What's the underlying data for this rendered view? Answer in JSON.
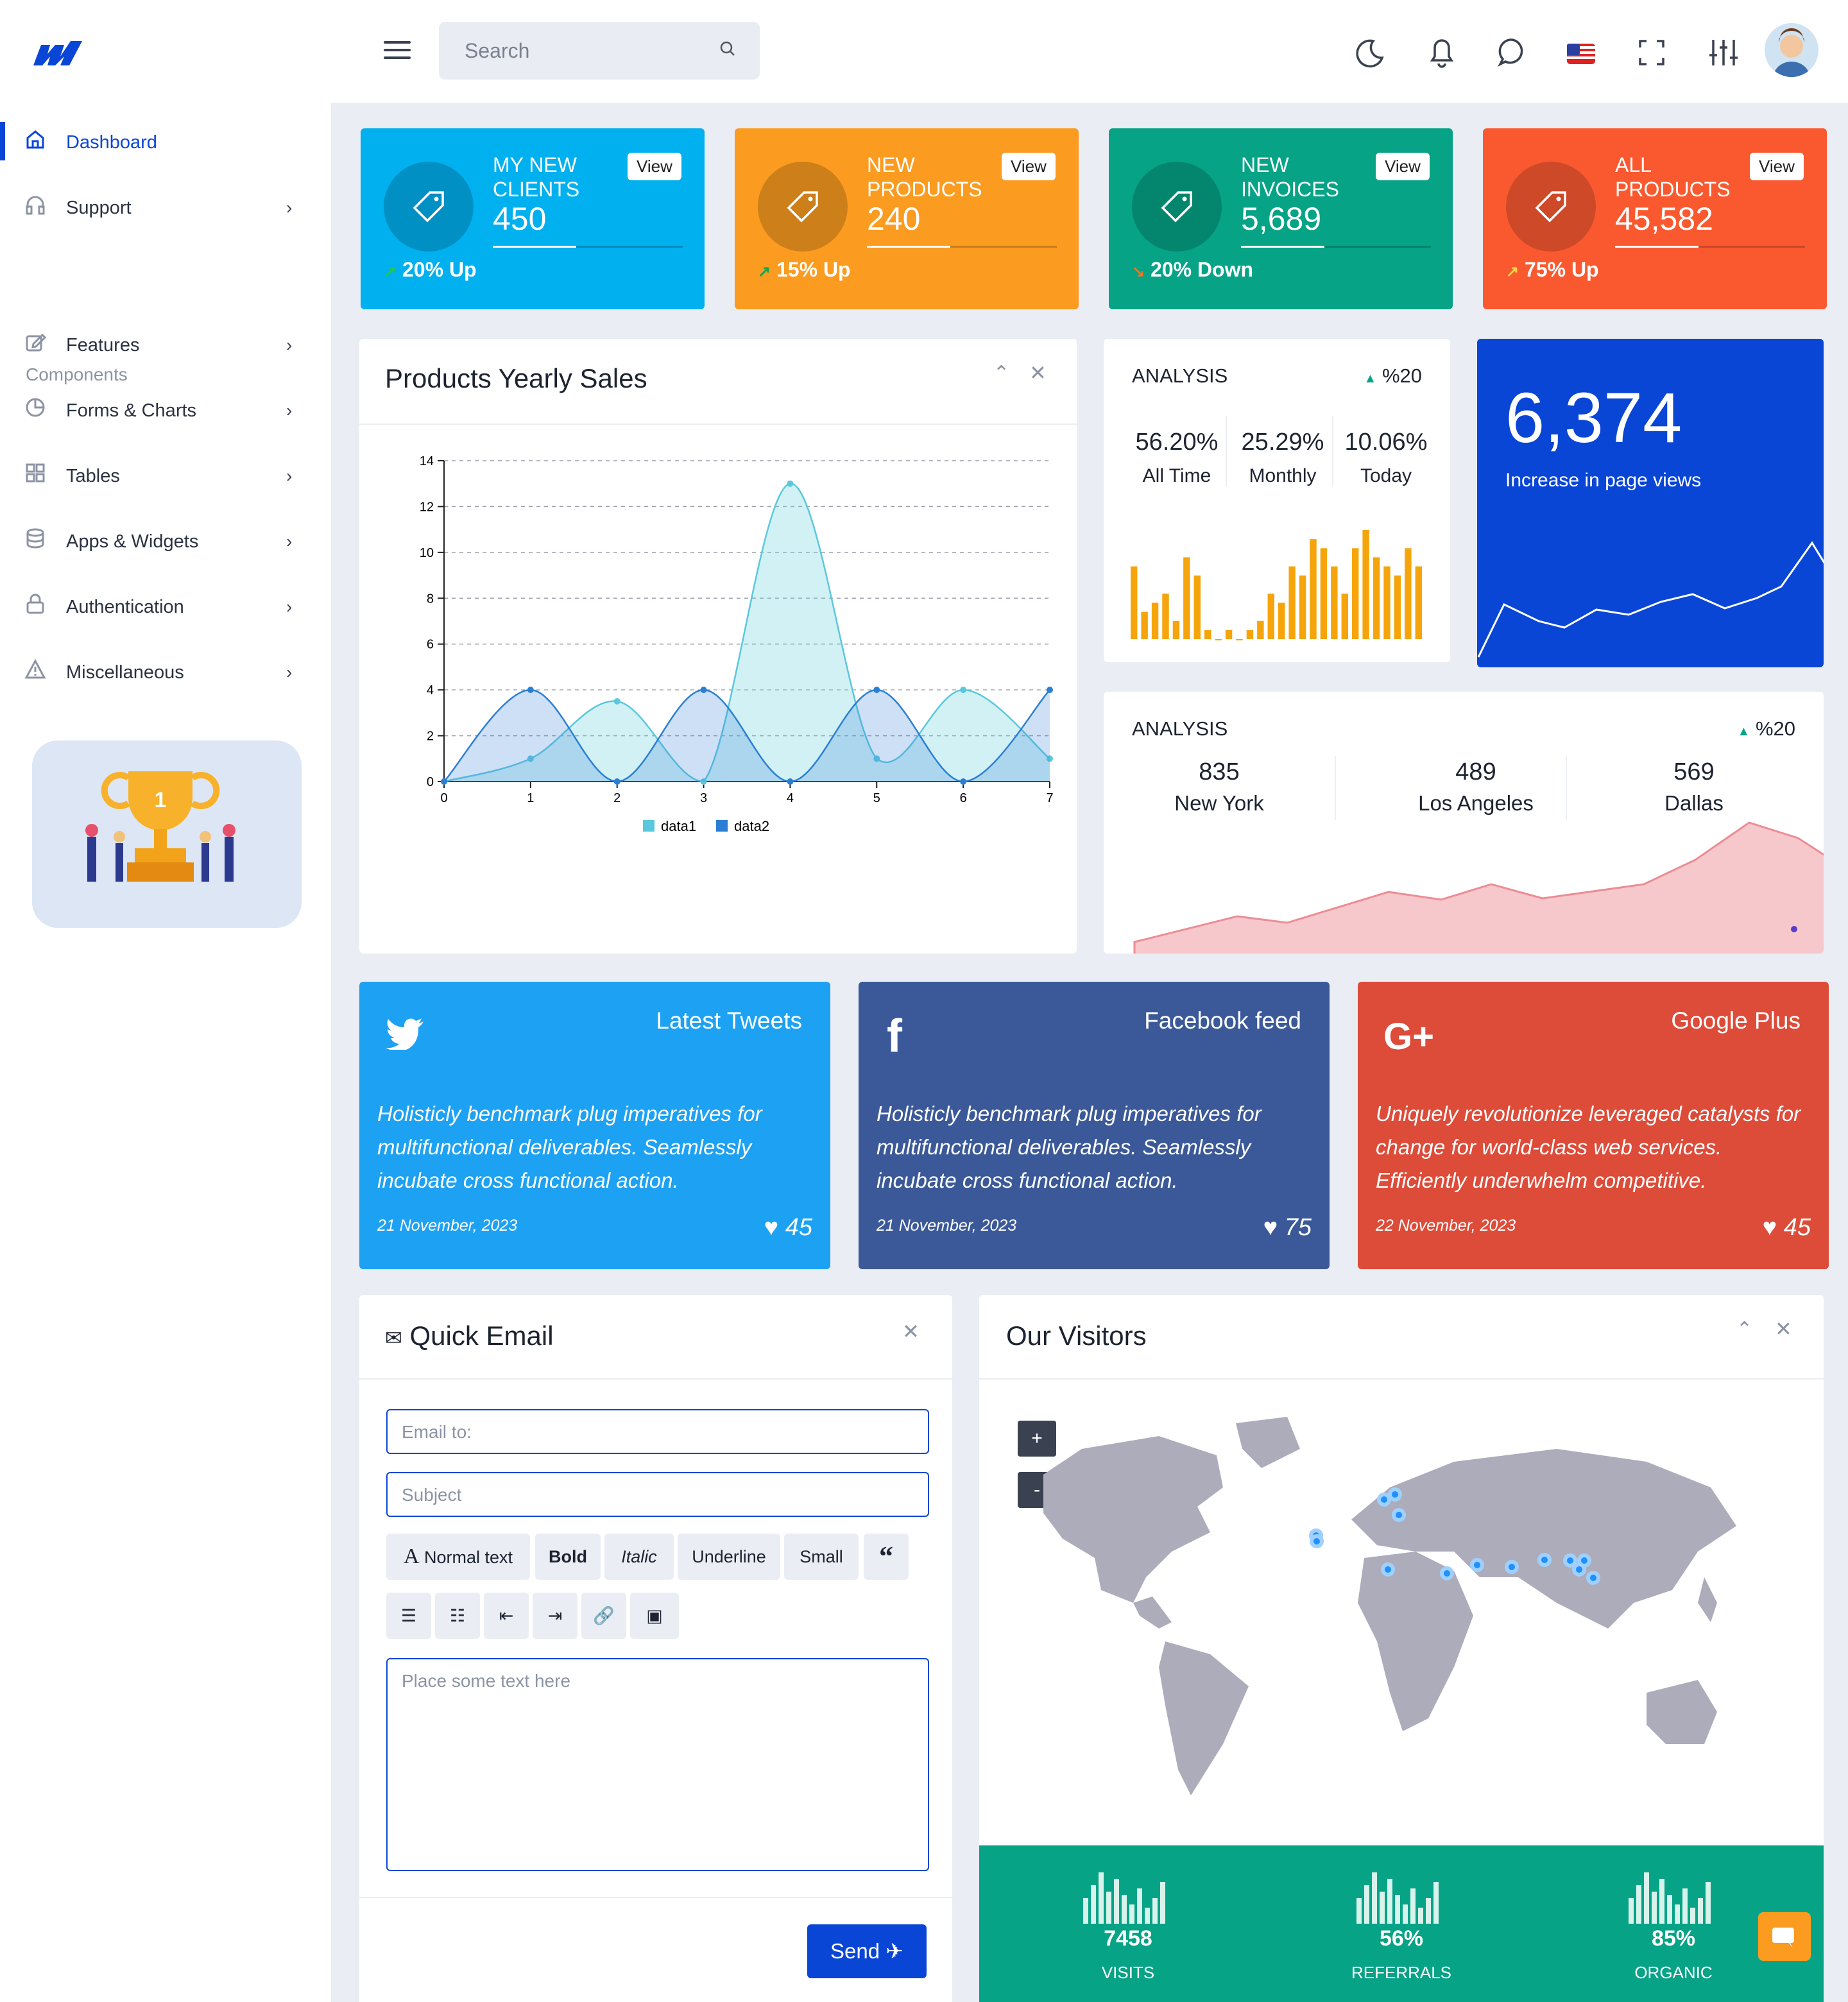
{
  "header": {
    "search_placeholder": "Search"
  },
  "sidebar": {
    "items": [
      {
        "label": "Dashboard"
      },
      {
        "label": "Support"
      },
      {
        "label": "Features"
      },
      {
        "label": "Forms & Charts"
      },
      {
        "label": "Tables"
      },
      {
        "label": "Apps & Widgets"
      },
      {
        "label": "Authentication"
      },
      {
        "label": "Miscellaneous"
      }
    ],
    "section": "Components"
  },
  "stats": [
    {
      "line1": "MY NEW",
      "line2": "CLIENTS",
      "value": "450",
      "view": "View",
      "trend": "20% Up",
      "color": "#00b0ef"
    },
    {
      "line1": "NEW",
      "line2": "PRODUCTS",
      "value": "240",
      "view": "View",
      "trend": "15% Up",
      "color": "#fb9b20"
    },
    {
      "line1": "NEW",
      "line2": "INVOICES",
      "value": "5,689",
      "view": "View",
      "trend": "20% Down",
      "color": "#06a386"
    },
    {
      "line1": "ALL",
      "line2": "PRODUCTS",
      "value": "45,582",
      "view": "View",
      "trend": "75% Up",
      "color": "#fa5930"
    }
  ],
  "sales": {
    "title": "Products Yearly Sales"
  },
  "chart_data": {
    "type": "area",
    "x": [
      0,
      1,
      2,
      3,
      4,
      5,
      6,
      7
    ],
    "series": [
      {
        "name": "data1",
        "values": [
          0,
          1,
          3.5,
          0,
          13,
          1,
          4,
          1
        ]
      },
      {
        "name": "data2",
        "values": [
          0,
          4,
          0,
          4,
          0,
          4,
          0,
          4
        ]
      }
    ],
    "ylim": [
      0,
      14
    ],
    "yticks": [
      0,
      2,
      4,
      6,
      8,
      10,
      12,
      14
    ],
    "xticks": [
      0,
      1,
      2,
      3,
      4,
      5,
      6,
      7
    ],
    "grid": true,
    "legend": "bottom"
  },
  "analysis1": {
    "title": "ANALYSIS",
    "badge": "%20",
    "items": [
      {
        "v": "56.20%",
        "l": "All Time"
      },
      {
        "v": "25.29%",
        "l": "Monthly"
      },
      {
        "v": "10.06%",
        "l": "Today"
      }
    ],
    "bars": [
      8,
      3,
      4,
      5,
      2,
      9,
      7,
      1,
      0,
      1,
      0,
      1,
      2,
      5,
      4,
      8,
      7,
      11,
      10,
      8,
      5,
      10,
      12,
      9,
      8,
      7,
      10,
      8
    ]
  },
  "pageviews": {
    "value": "6,374",
    "label": "Increase in page views"
  },
  "analysis2": {
    "title": "ANALYSIS",
    "badge": "%20",
    "items": [
      {
        "v": "835",
        "l": "New York"
      },
      {
        "v": "489",
        "l": "Los Angeles"
      },
      {
        "v": "569",
        "l": "Dallas"
      }
    ]
  },
  "social": [
    {
      "title": "Latest Tweets",
      "text": "Holisticly benchmark plug imperatives for multifunctional deliverables. Seamlessly incubate cross functional action.",
      "date": "21 November, 2023",
      "likes": "45",
      "color": "#1da1f2"
    },
    {
      "title": "Facebook feed",
      "text": "Holisticly benchmark plug imperatives for multifunctional deliverables. Seamlessly incubate cross functional action.",
      "date": "21 November, 2023",
      "likes": "75",
      "color": "#3b5998"
    },
    {
      "title": "Google Plus",
      "text": "Uniquely revolutionize leveraged catalysts for change for world-class web services. Efficiently underwhelm competitive.",
      "date": "22 November, 2023",
      "likes": "45",
      "color": "#dd4b39"
    }
  ],
  "email": {
    "title": "Quick Email",
    "to_placeholder": "Email to:",
    "subject_placeholder": "Subject",
    "body_placeholder": "Place some text here",
    "send": "Send",
    "toolbar": [
      "Normal text",
      "Bold",
      "Italic",
      "Underline",
      "Small"
    ]
  },
  "visitors": {
    "title": "Our Visitors",
    "zoom_in": "+",
    "zoom_out": "-",
    "stats": [
      {
        "n": "7458",
        "l": "VISITS"
      },
      {
        "n": "56%",
        "l": "REFERRALS"
      },
      {
        "n": "85%",
        "l": "ORGANIC"
      }
    ]
  }
}
